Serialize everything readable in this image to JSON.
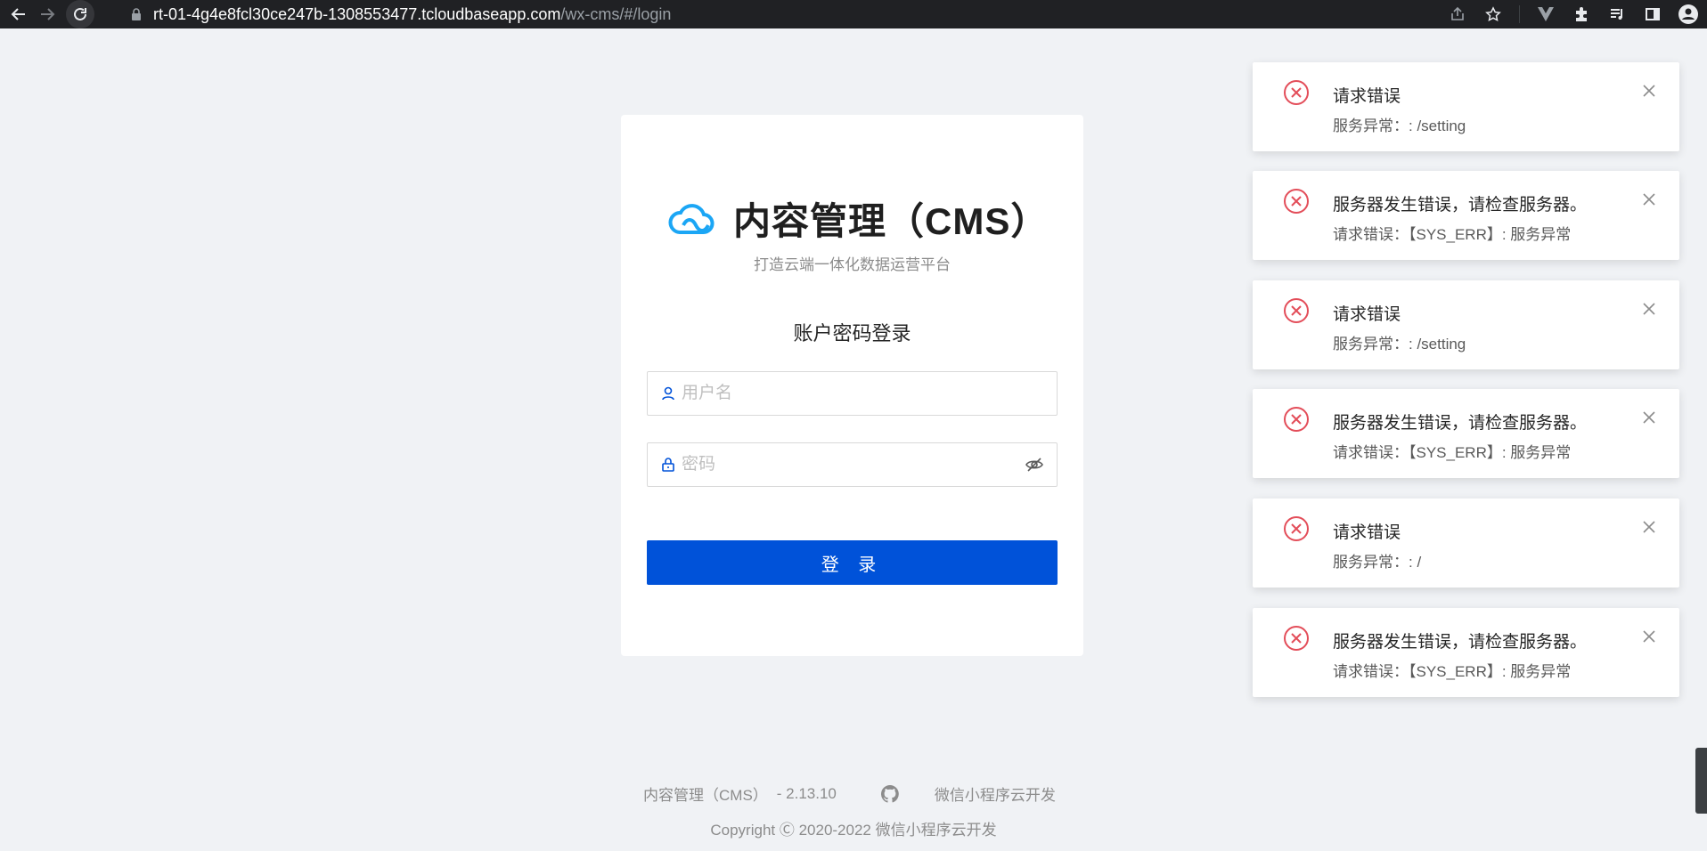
{
  "browser": {
    "url_host": "rt-01-4g4e8fcl30ce247b-1308553477.tcloudbaseapp.com",
    "url_path": "/wx-cms/#/login",
    "icons": [
      "back-arrow-icon",
      "forward-arrow-icon",
      "reload-icon",
      "lock-icon",
      "share-icon",
      "star-icon",
      "vue-devtools-icon",
      "extensions-icon",
      "media-control-icon",
      "side-panel-icon",
      "profile-icon"
    ]
  },
  "login": {
    "title": "内容管理（CMS）",
    "subtitle": "打造云端一体化数据运营平台",
    "heading": "账户密码登录",
    "username_placeholder": "用户名",
    "password_placeholder": "密码",
    "submit_label": "登 录",
    "accent_color": "#0052d9",
    "logo_color": "#1ba6f5"
  },
  "footer": {
    "product": "内容管理（CMS）",
    "version": "- 2.13.10",
    "link_label": "微信小程序云开发",
    "copyright": "Copyright Ⓒ 2020-2022 微信小程序云开发"
  },
  "notifications": [
    {
      "title": "请求错误",
      "desc": "服务异常：: /setting"
    },
    {
      "title": "服务器发生错误，请检查服务器。",
      "desc": "请求错误：【SYS_ERR】: 服务异常"
    },
    {
      "title": "请求错误",
      "desc": "服务异常：: /setting"
    },
    {
      "title": "服务器发生错误，请检查服务器。",
      "desc": "请求错误：【SYS_ERR】: 服务异常"
    },
    {
      "title": "请求错误",
      "desc": "服务异常：: /"
    },
    {
      "title": "服务器发生错误，请检查服务器。",
      "desc": "请求错误：【SYS_ERR】: 服务异常"
    }
  ],
  "error_color": "#e34d59"
}
